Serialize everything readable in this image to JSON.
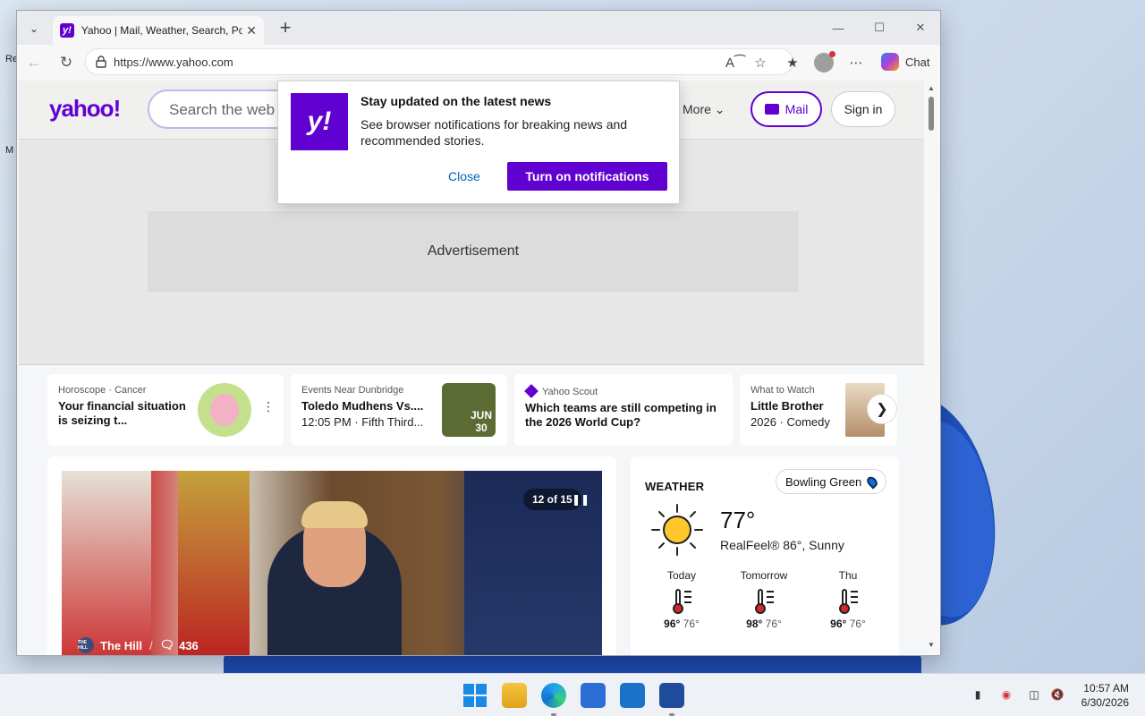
{
  "desktop": {
    "icon_labels": [
      "Re",
      "M"
    ]
  },
  "browser": {
    "tab": {
      "favicon": "y!",
      "title": "Yahoo | Mail, Weather, Search, Politics"
    },
    "new_tab_symbol": "+",
    "url": "https://www.yahoo.com",
    "copilot_label": "Chat",
    "icons": [
      "tab-actions-icon",
      "back-icon",
      "refresh-icon",
      "lock-icon",
      "read-aloud-icon",
      "favorite-star-icon",
      "favorites-icon",
      "profile-icon",
      "more-icon",
      "minimize-icon",
      "maximize-icon",
      "close-icon"
    ]
  },
  "yahoo": {
    "logo": "yahoo!",
    "search_placeholder": "Search the web",
    "more_label": "More",
    "mail_label": "Mail",
    "signin_label": "Sign in",
    "ad_label": "Advertisement"
  },
  "notification": {
    "logo": "y!",
    "title": "Stay updated on the latest news",
    "body": "See browser notifications for breaking news and recommended stories.",
    "close_label": "Close",
    "turn_on_label": "Turn on notifications"
  },
  "cards": [
    {
      "kicker": "Horoscope · Cancer",
      "title": "Your financial situation is seizing t..."
    },
    {
      "kicker": "Events Near Dunbridge",
      "title": "Toledo Mudhens Vs....",
      "sub": "12:05 PM · Fifth Third...",
      "thumb_month": "JUN",
      "thumb_day": "30"
    },
    {
      "kicker": "Yahoo Scout",
      "title": "Which teams are still competing in the 2026 World Cup?"
    },
    {
      "kicker": "What to Watch",
      "title": "Little Brother",
      "sub": "2026 · Comedy"
    }
  ],
  "news": {
    "slide_counter": "12 of 15",
    "source": "The Hill",
    "source_logo": "THE HILL",
    "separator": "/",
    "comments": "436"
  },
  "weather": {
    "title": "WEATHER",
    "location": "Bowling Green",
    "temp": "77°",
    "realfeel": "RealFeel® 86°, Sunny",
    "forecast": [
      {
        "day": "Today",
        "hi": "96°",
        "lo": "76°"
      },
      {
        "day": "Tomorrow",
        "hi": "98°",
        "lo": "76°"
      },
      {
        "day": "Thu",
        "hi": "96°",
        "lo": "76°"
      }
    ]
  },
  "taskbar": {
    "time": "10:57 AM",
    "date": "6/30/2026"
  }
}
